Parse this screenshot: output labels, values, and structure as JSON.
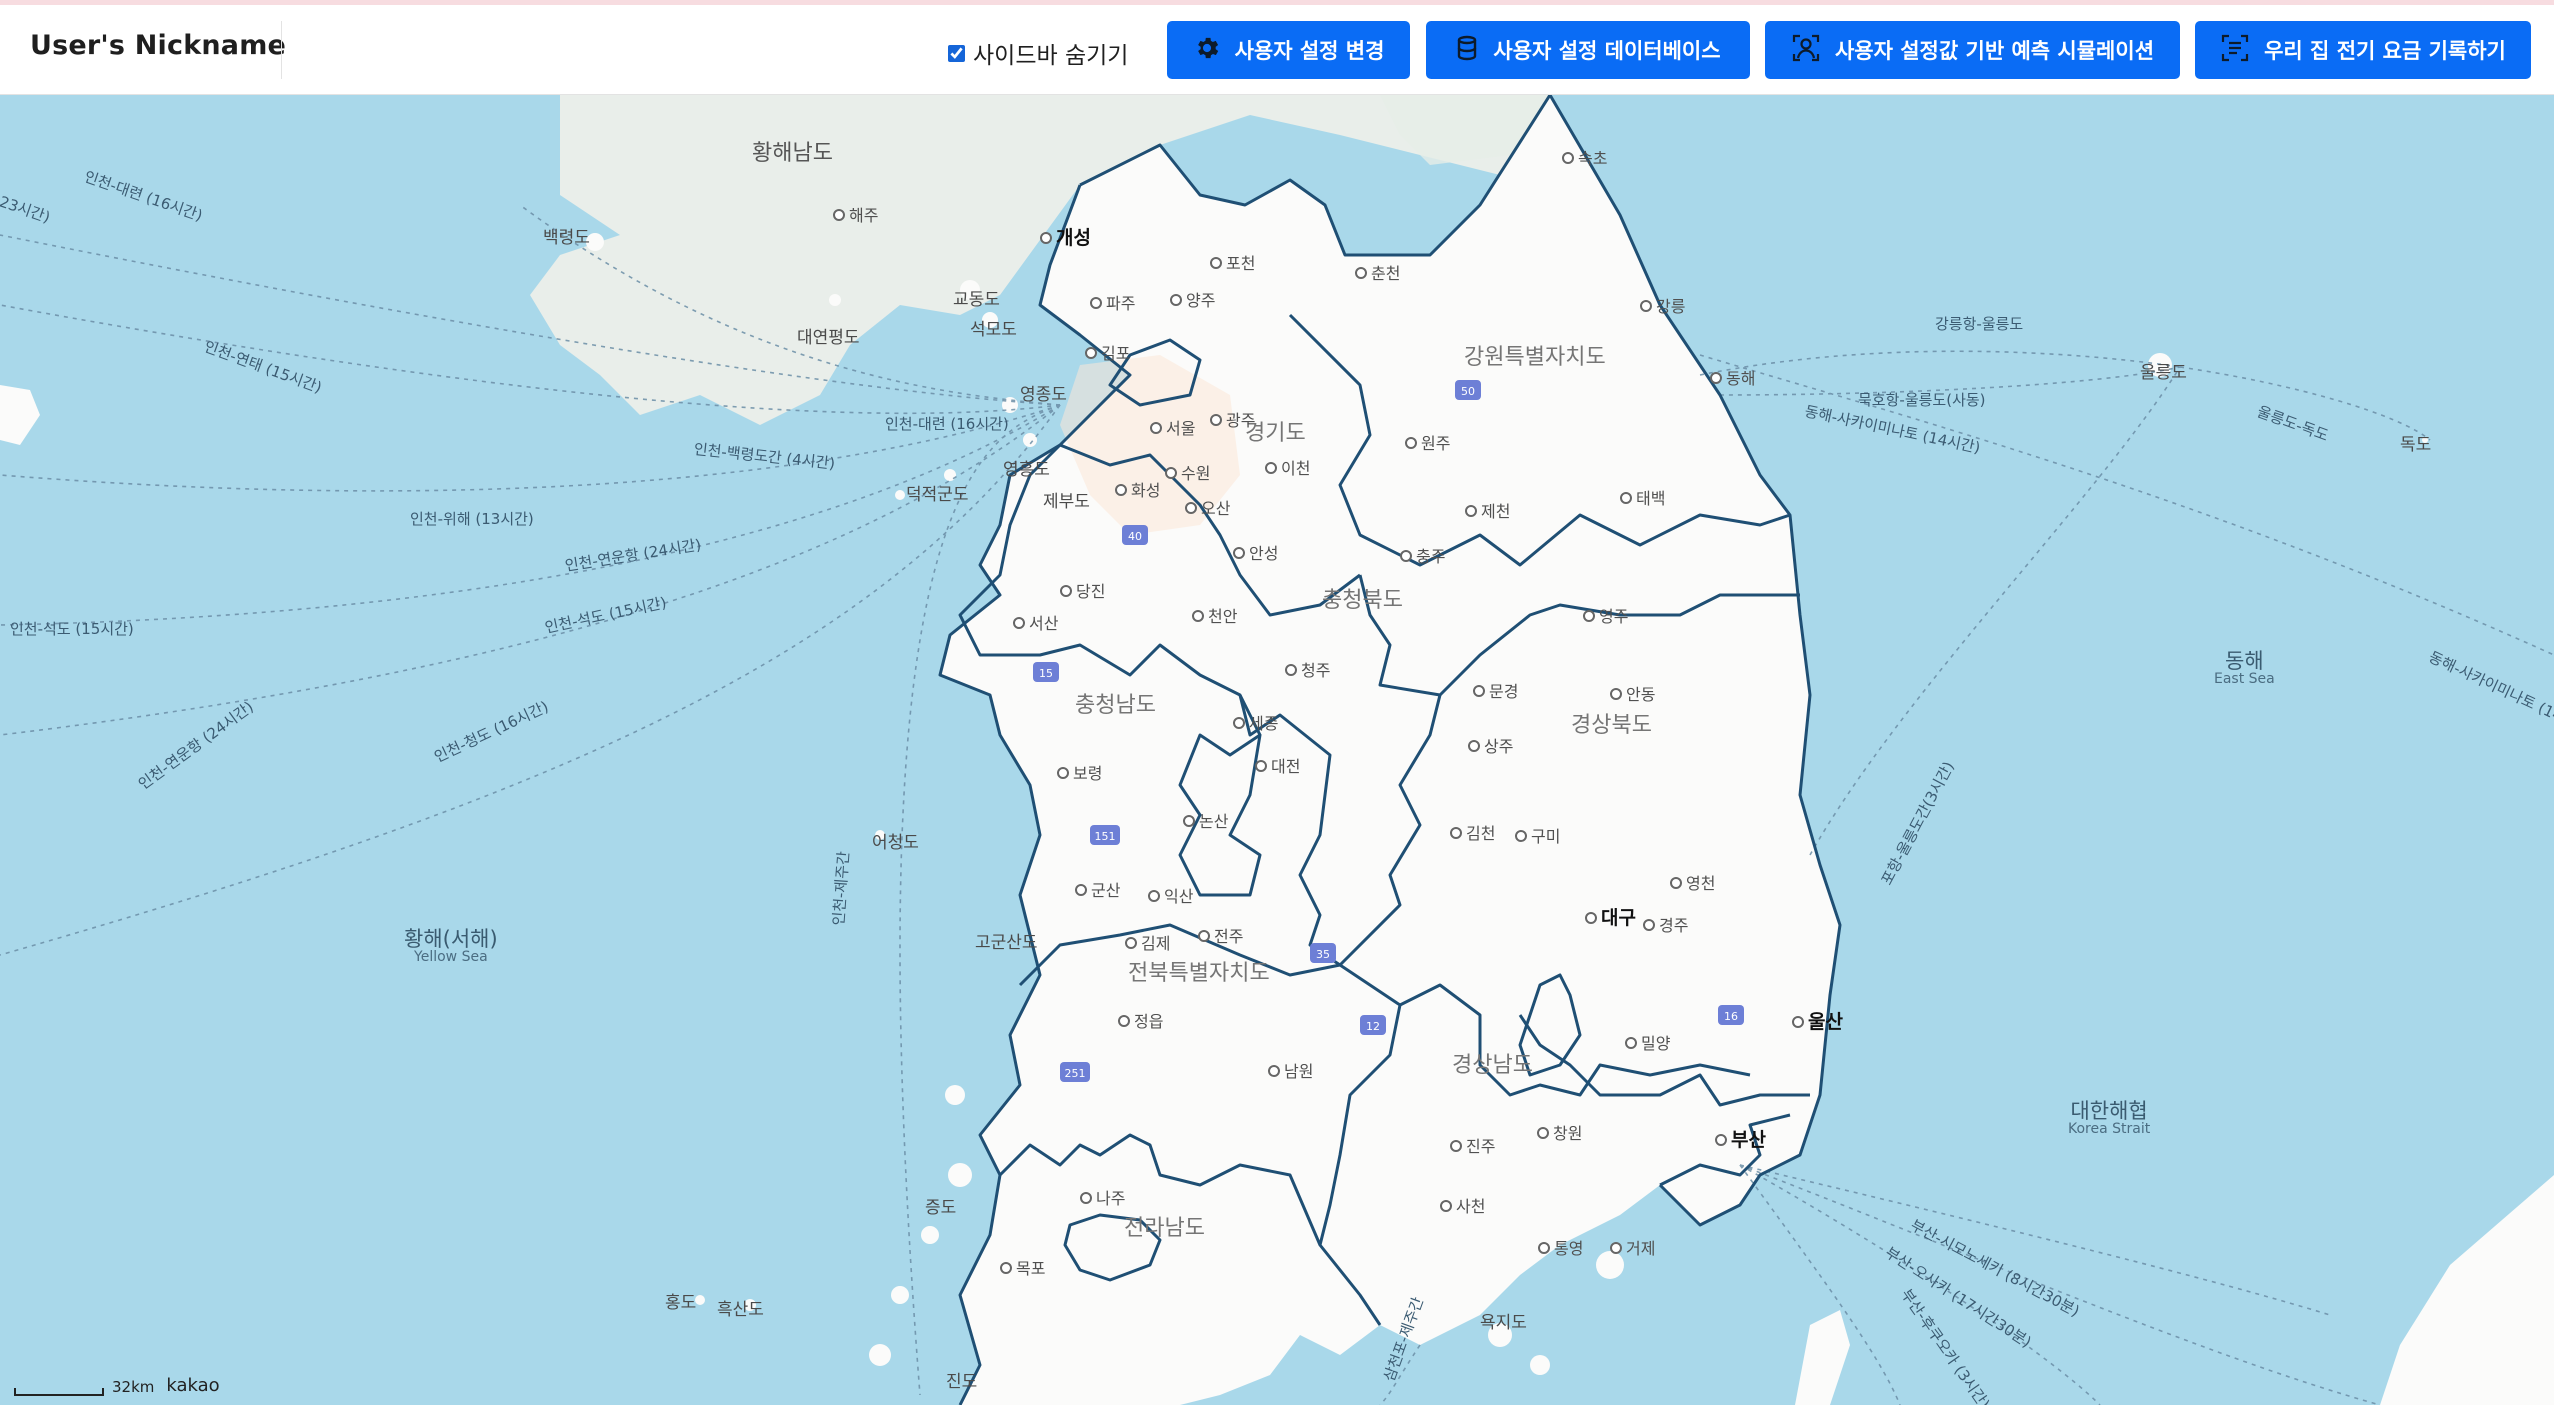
{
  "header": {
    "nickname": "User's Nickname",
    "sidebar_toggle_label": "사이드바 숨기기",
    "sidebar_hidden": true,
    "buttons": [
      {
        "label": "사용자 설정 변경",
        "icon": "gear-icon"
      },
      {
        "label": "사용자 설정 데이터베이스",
        "icon": "database-icon"
      },
      {
        "label": "사용자 설정값 기반 예측 시뮬레이션",
        "icon": "user-scan-icon"
      },
      {
        "label": "우리 집 전기 요금 기록하기",
        "icon": "document-scan-icon"
      }
    ],
    "accent_color": "#0a6cf5"
  },
  "map": {
    "provider": "kakao",
    "scale": "32km",
    "sea_color": "#a9d8ea",
    "land_color": "#fbfbfa",
    "boundary_color": "#1f4f74",
    "regions": [
      "강원특별자치도",
      "경기도",
      "충청북도",
      "충청남도",
      "경상북도",
      "전북특별자치도",
      "경상남도",
      "전라남도",
      "황해남도"
    ],
    "seas": [
      {
        "name": "황해(서해)",
        "sub": "Yellow Sea"
      },
      {
        "name": "동해",
        "sub": "East Sea"
      },
      {
        "name": "대한해협",
        "sub": "Korea Strait"
      }
    ],
    "cities": [
      "서울",
      "포천",
      "춘천",
      "파주",
      "양주",
      "김포",
      "광주",
      "이천",
      "원주",
      "수원",
      "화성",
      "오산",
      "안성",
      "충주",
      "제천",
      "태백",
      "당진",
      "서산",
      "천안",
      "청주",
      "세종",
      "대전",
      "논산",
      "보령",
      "영주",
      "문경",
      "안동",
      "상주",
      "김천",
      "구미",
      "영천",
      "경주",
      "군산",
      "익산",
      "김제",
      "전주",
      "정읍",
      "남원",
      "밀양",
      "창원",
      "진주",
      "사천",
      "통영",
      "거제",
      "나주",
      "목포",
      "해주",
      "개성",
      "속초",
      "강릉",
      "동해",
      "울릉도",
      "독도"
    ],
    "bold_cities": [
      "대구",
      "울산",
      "부산"
    ],
    "islands": [
      "백령도",
      "교동도",
      "석모도",
      "대연평도",
      "영흥도",
      "영종도",
      "제부도",
      "덕적군도",
      "어청도",
      "고군산도",
      "증도",
      "홍도",
      "흑산도",
      "진도",
      "욕지도"
    ],
    "routes": [
      "인천-대련 (16시간)",
      "23시간)",
      "인천-연태 (15시간)",
      "인천-대련 (16시간)",
      "인천-백령도간 (4시간)",
      "인천-위해 (13시간)",
      "인천-연운항 (24시간)",
      "인천-석도 (15시간)",
      "인천-석도 (15시간)",
      "인천-연운항 (24시간)",
      "인천-청도 (16시간)",
      "인천-제주간",
      "강릉항-울릉도",
      "묵호항-울릉도(사동)",
      "동해-사카이미나토 (14시간)",
      "울릉도-독도",
      "동해-사카이미나토 (14",
      "포항-울릉도간(3시간)",
      "부산-시모노세키 (8시간30분)",
      "부산-오사카 (17시간30분)",
      "부산-후쿠오카 (3시간)",
      "삼천포-제주간"
    ]
  }
}
